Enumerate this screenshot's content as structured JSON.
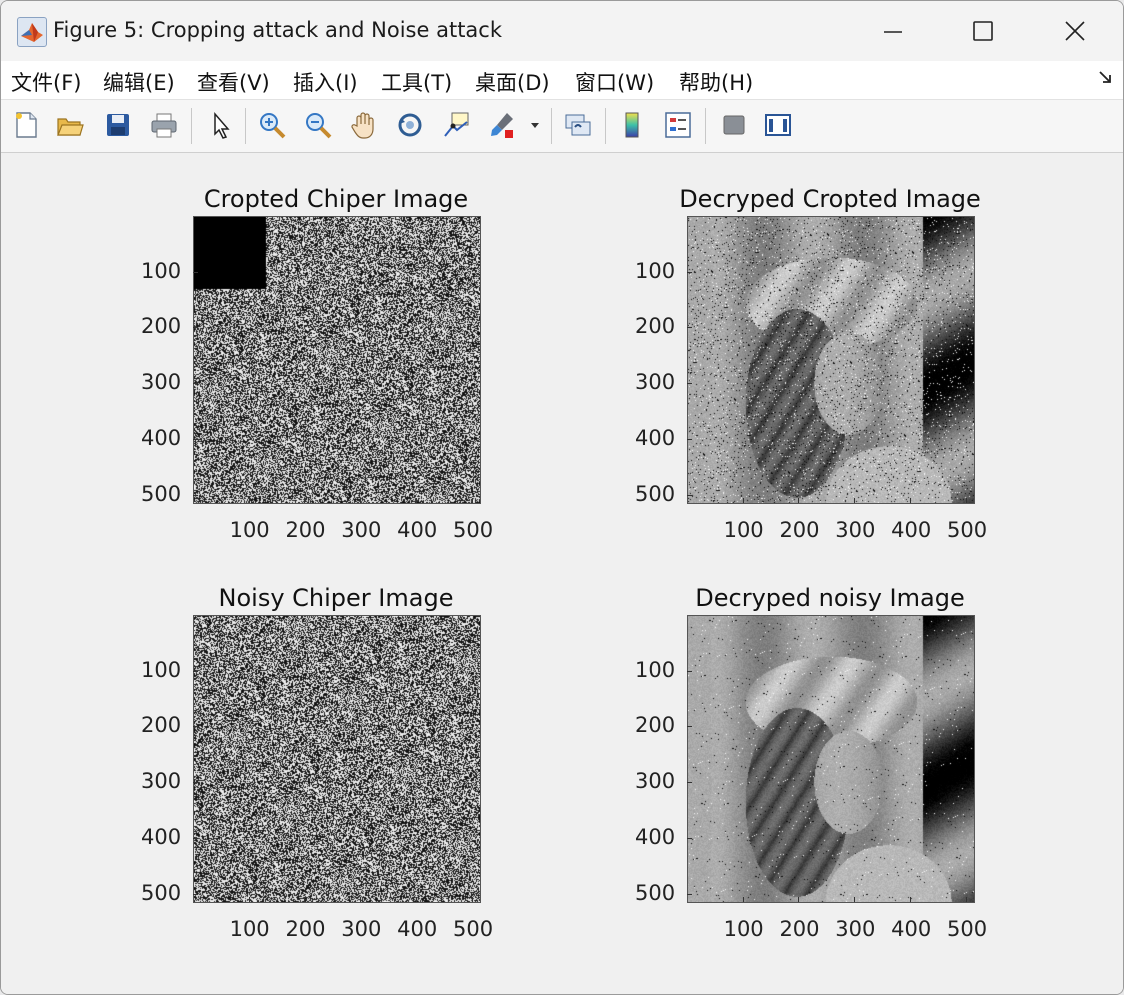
{
  "window": {
    "title": "Figure 5: Cropping attack and Noise attack",
    "minimize_label": "—",
    "maximize_label": "☐",
    "close_label": "✕"
  },
  "menu": {
    "items": [
      "文件(F)",
      "编辑(E)",
      "查看(V)",
      "插入(I)",
      "工具(T)",
      "桌面(D)",
      "窗口(W)",
      "帮助(H)"
    ],
    "overflow_icon": "expand-arrow-icon"
  },
  "toolbar": {
    "buttons": [
      {
        "icon": "new-figure-icon"
      },
      {
        "icon": "open-file-icon"
      },
      {
        "icon": "save-icon"
      },
      {
        "icon": "print-icon"
      },
      {
        "icon": "select-arrow-icon"
      },
      {
        "icon": "zoom-in-icon"
      },
      {
        "icon": "zoom-out-icon"
      },
      {
        "icon": "pan-hand-icon"
      },
      {
        "icon": "rotate-3d-icon"
      },
      {
        "icon": "data-cursor-icon"
      },
      {
        "icon": "brush-icon"
      },
      {
        "icon": "brush-dropdown-icon"
      },
      {
        "icon": "link-plot-icon"
      },
      {
        "icon": "colorbar-icon"
      },
      {
        "icon": "legend-icon"
      },
      {
        "icon": "hide-plot-tools-icon"
      },
      {
        "icon": "show-plot-tools-icon"
      }
    ]
  },
  "subplots": [
    {
      "title": "Cropted Chiper Image",
      "kind": "noise",
      "crop_fraction": 0.25
    },
    {
      "title": "Decryped Cropted Image",
      "kind": "photo",
      "speckle": "heavy"
    },
    {
      "title": "Noisy Chiper Image",
      "kind": "noise",
      "crop_fraction": 0
    },
    {
      "title": "Decryped noisy Image",
      "kind": "photo",
      "speckle": "light"
    }
  ],
  "axis_ticks": [
    "100",
    "200",
    "300",
    "400",
    "500"
  ],
  "colors": {
    "window_bg": "#f0f0f0",
    "menubar_bg": "#ffffff",
    "toolbar_bg": "#f6f6f6"
  }
}
